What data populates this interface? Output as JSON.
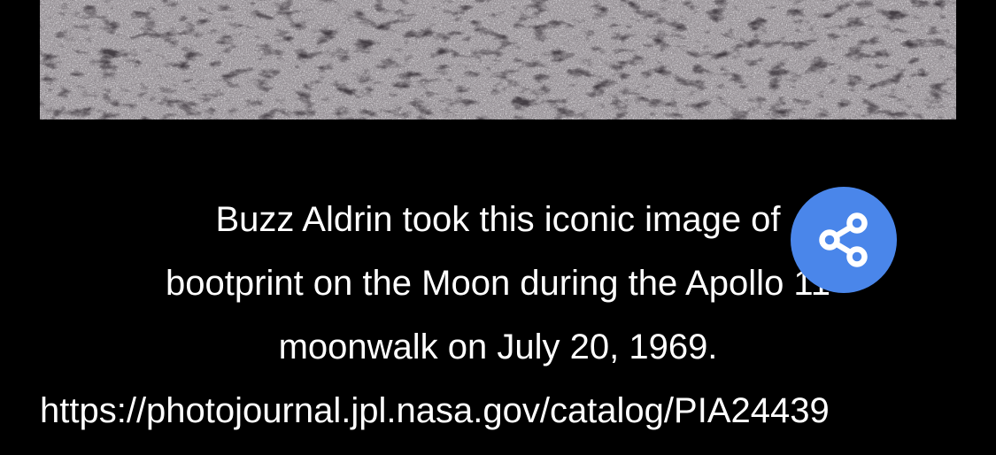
{
  "photo": {
    "alt": "lunar surface"
  },
  "caption": {
    "lines": [
      "Buzz Aldrin took this iconic image of",
      "bootprint on the Moon during the Apollo 11",
      "moonwalk on July 20, 1969."
    ],
    "link": "https://photojournal.jpl.nasa.gov/catalog/PIA24439"
  },
  "share": {
    "icon": "share-icon",
    "color": "#4a86ea"
  },
  "colors": {
    "background": "#000000",
    "text": "#ffffff"
  }
}
